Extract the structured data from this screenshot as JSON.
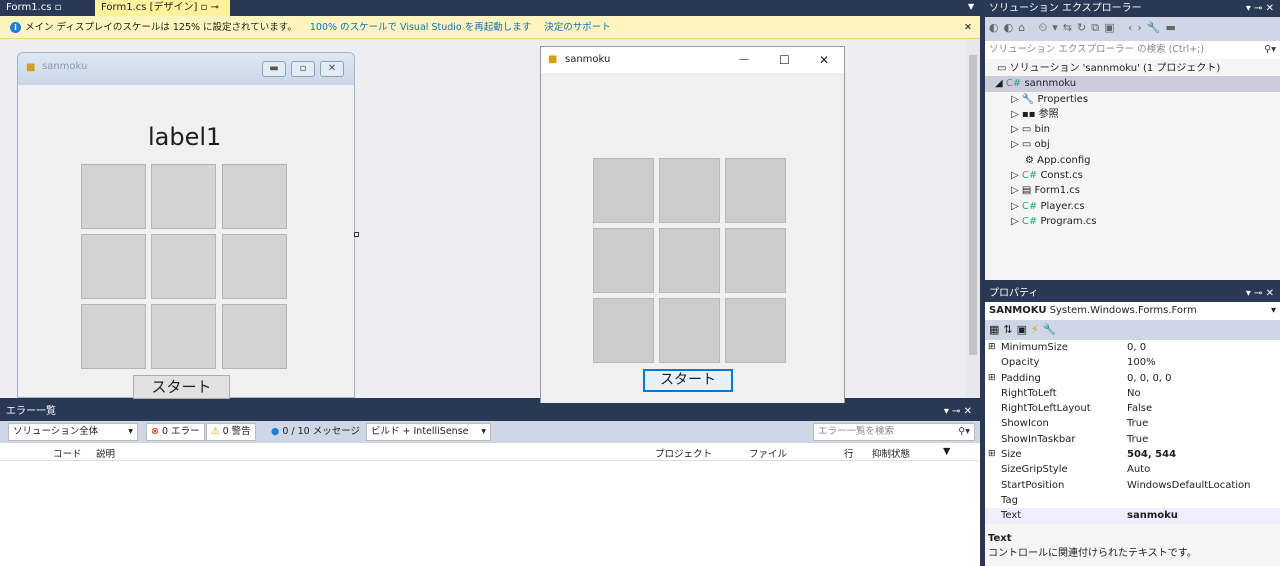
{
  "tabs": [
    {
      "label": "Form1.cs"
    },
    {
      "label": "Form1.cs [デザイン]"
    }
  ],
  "infobar": {
    "message": "メイン ディスプレイのスケールは 125% に設定されています。",
    "link1": "100% のスケールで Visual Studio を再起動します",
    "link2": "決定のサポート"
  },
  "design_form": {
    "title": "sanmoku",
    "label": "label1",
    "button": "スタート"
  },
  "run_form": {
    "title": "sanmoku",
    "button": "スタート"
  },
  "error_list": {
    "title": "エラー一覧",
    "scope": "ソリューション全体",
    "errors": "0 エラー",
    "warnings": "0 警告",
    "messages": "0 / 10 メッセージ",
    "build": "ビルド + IntelliSense",
    "search_placeholder": "エラー一覧を検索",
    "columns": [
      "コード",
      "説明",
      "プロジェクト",
      "ファイル",
      "行",
      "抑制状態"
    ]
  },
  "solution_explorer": {
    "title": "ソリューション エクスプローラー",
    "search_placeholder": "ソリューション エクスプローラー の検索 (Ctrl+;)",
    "solution": "ソリューション 'sannmoku' (1 プロジェクト)",
    "project": "sannmoku",
    "items": [
      "Properties",
      "参照",
      "bin",
      "obj",
      "App.config",
      "Const.cs",
      "Form1.cs",
      "Player.cs",
      "Program.cs"
    ]
  },
  "properties": {
    "title": "プロパティ",
    "object_name": "SANMOKU",
    "object_type": "System.Windows.Forms.Form",
    "rows": [
      {
        "name": "MinimumSize",
        "value": "0, 0",
        "expand": "⊞"
      },
      {
        "name": "Opacity",
        "value": "100%"
      },
      {
        "name": "Padding",
        "value": "0, 0, 0, 0",
        "expand": "⊞"
      },
      {
        "name": "RightToLeft",
        "value": "No"
      },
      {
        "name": "RightToLeftLayout",
        "value": "False"
      },
      {
        "name": "ShowIcon",
        "value": "True"
      },
      {
        "name": "ShowInTaskbar",
        "value": "True"
      },
      {
        "name": "Size",
        "value": "504, 544",
        "expand": "⊞",
        "bold": true
      },
      {
        "name": "SizeGripStyle",
        "value": "Auto"
      },
      {
        "name": "StartPosition",
        "value": "WindowsDefaultLocation"
      },
      {
        "name": "Tag",
        "value": ""
      },
      {
        "name": "Text",
        "value": "sanmoku",
        "bold": true
      }
    ],
    "desc_title": "Text",
    "desc": "コントロールに関連付けられたテキストです。"
  }
}
